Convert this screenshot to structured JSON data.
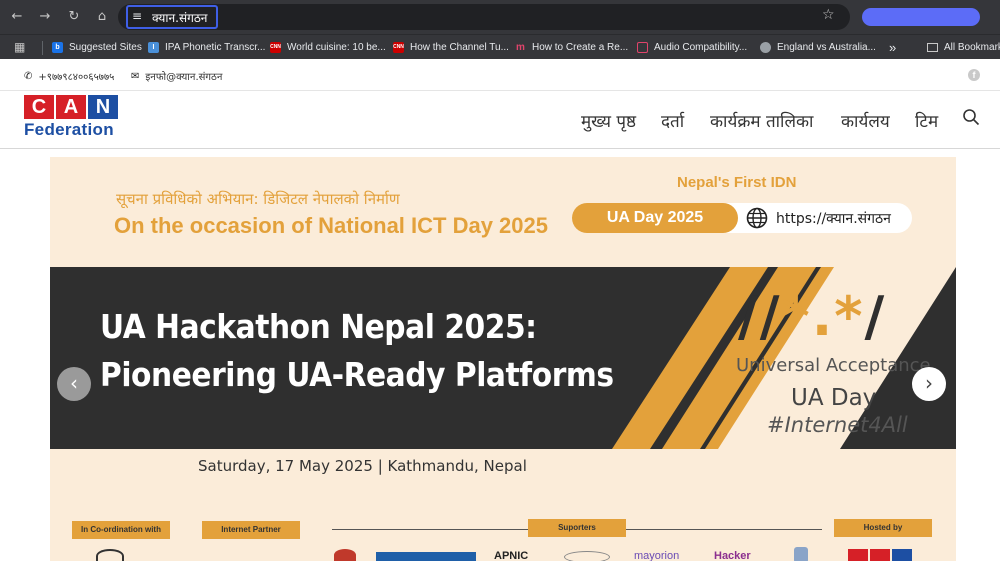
{
  "browser": {
    "url": "क्यान.संगठन",
    "bookmarks": [
      {
        "label": "Suggested Sites",
        "color": "#1a73e8",
        "glyph": "b"
      },
      {
        "label": "IPA Phonetic Transcr...",
        "color": "#4a90d9",
        "glyph": "I"
      },
      {
        "label": "World cuisine: 10 be...",
        "color": "#cc0000",
        "glyph": "CNN"
      },
      {
        "label": "How the Channel Tu...",
        "color": "#cc0000",
        "glyph": "CNN"
      },
      {
        "label": "How to Create a Re...",
        "color": "#35363a",
        "glyph": "m"
      },
      {
        "label": "Audio Compatibility...",
        "color": "#35363a",
        "glyph": "[]"
      },
      {
        "label": "England vs Australia...",
        "color": "#5f6368",
        "glyph": "o"
      }
    ],
    "more_label": "»",
    "all_bookmarks_label": "All Bookmarks"
  },
  "topbar": {
    "phone": "+९७७९८४००६५७७५",
    "email": "इनफो@क्यान.संगठन"
  },
  "logo": {
    "letters": [
      "C",
      "A",
      "N"
    ],
    "subtitle": "Federation"
  },
  "menu": {
    "items": [
      "मुख्य पृष्ठ",
      "दर्ता",
      "कार्यक्रम तालिका",
      "कार्यलय",
      "टिम"
    ]
  },
  "banner": {
    "devanagari_heading": "सूचना प्रविधिको अभियान: डिजिटल नेपालको निर्माण",
    "occasion": "On the occasion of National ICT Day 2025",
    "first_idn": "Nepal's First IDN",
    "ua_day_pill": "UA Day 2025",
    "ua_url": "https://क्यान.संगठन",
    "title_line1": "UA Hackathon Nepal 2025:",
    "title_line2": "Pioneering UA-Ready Platforms",
    "ua_logo_text_a": "//",
    "ua_logo_text_b": "*.*",
    "ua_logo_text_c": "/",
    "universal_acceptance": "Universal Acceptance",
    "ua_day": "UA Day",
    "hashtag": "#Internet4All",
    "event_date": "Saturday, 17 May 2025  |  Kathmandu, Nepal",
    "prev_arrow": "‹",
    "next_arrow": "›"
  },
  "footer_tags": {
    "coordination": "In Co-ordination with",
    "internet_partner": "Internet Partner",
    "supporters": "Suporters",
    "hosted_by": "Hosted by"
  },
  "partners": [
    "APNIC",
    "mayorion",
    "Hacker"
  ]
}
